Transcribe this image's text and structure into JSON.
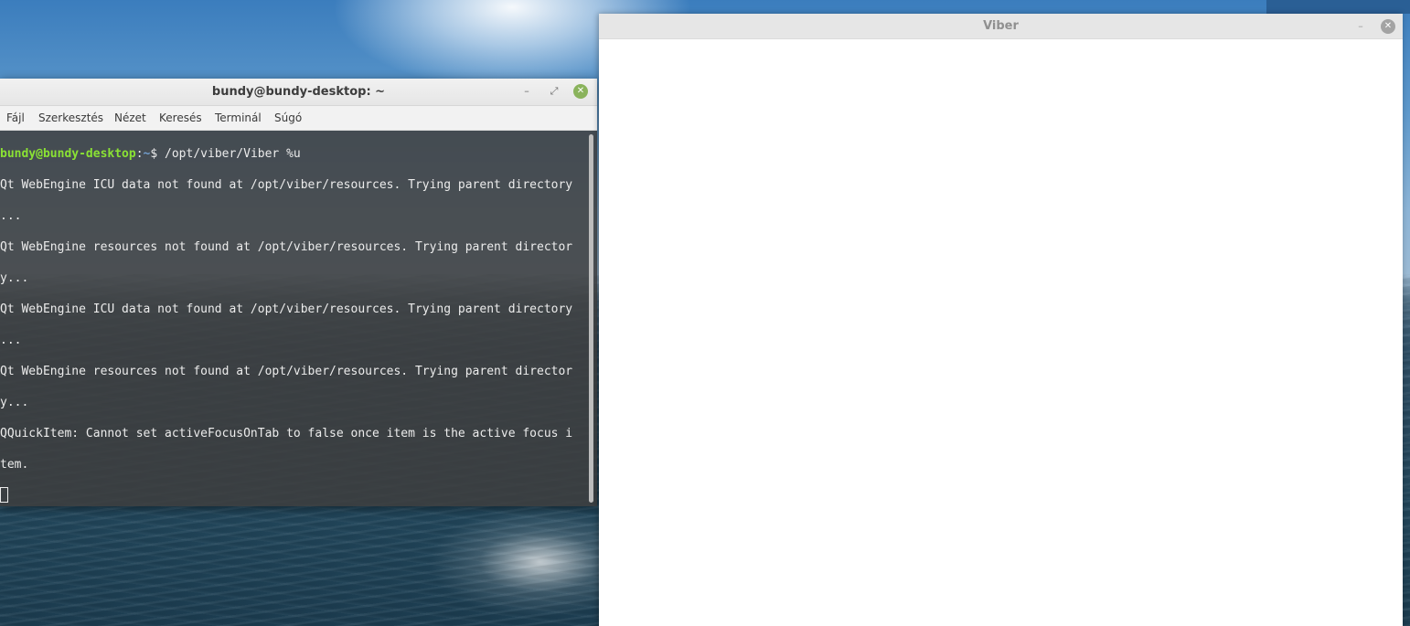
{
  "terminal": {
    "title": "bundy@bundy-desktop: ~",
    "buttons": {
      "minimize": "–",
      "maximize": "⤢",
      "close": "✕"
    },
    "menu": [
      "Fájl",
      "Szerkesztés",
      "Nézet",
      "Keresés",
      "Terminál",
      "Súgó"
    ],
    "prompt": {
      "user_host": "bundy@bundy-desktop",
      "separator": ":",
      "path": "~",
      "symbol": "$ ",
      "command": "/opt/viber/Viber %u"
    },
    "output": [
      "Qt WebEngine ICU data not found at /opt/viber/resources. Trying parent directory",
      "...",
      "Qt WebEngine resources not found at /opt/viber/resources. Trying parent director",
      "y...",
      "Qt WebEngine ICU data not found at /opt/viber/resources. Trying parent directory",
      "...",
      "Qt WebEngine resources not found at /opt/viber/resources. Trying parent director",
      "y...",
      "QQuickItem: Cannot set activeFocusOnTab to false once item is the active focus i",
      "tem."
    ]
  },
  "viber": {
    "title": "Viber",
    "buttons": {
      "minimize": "–",
      "close": "✕"
    }
  },
  "colors": {
    "prompt_user": "#8ae234",
    "prompt_path": "#729fcf",
    "terminal_bg": "#3e3e3e",
    "close_button": "#8ab35c"
  }
}
